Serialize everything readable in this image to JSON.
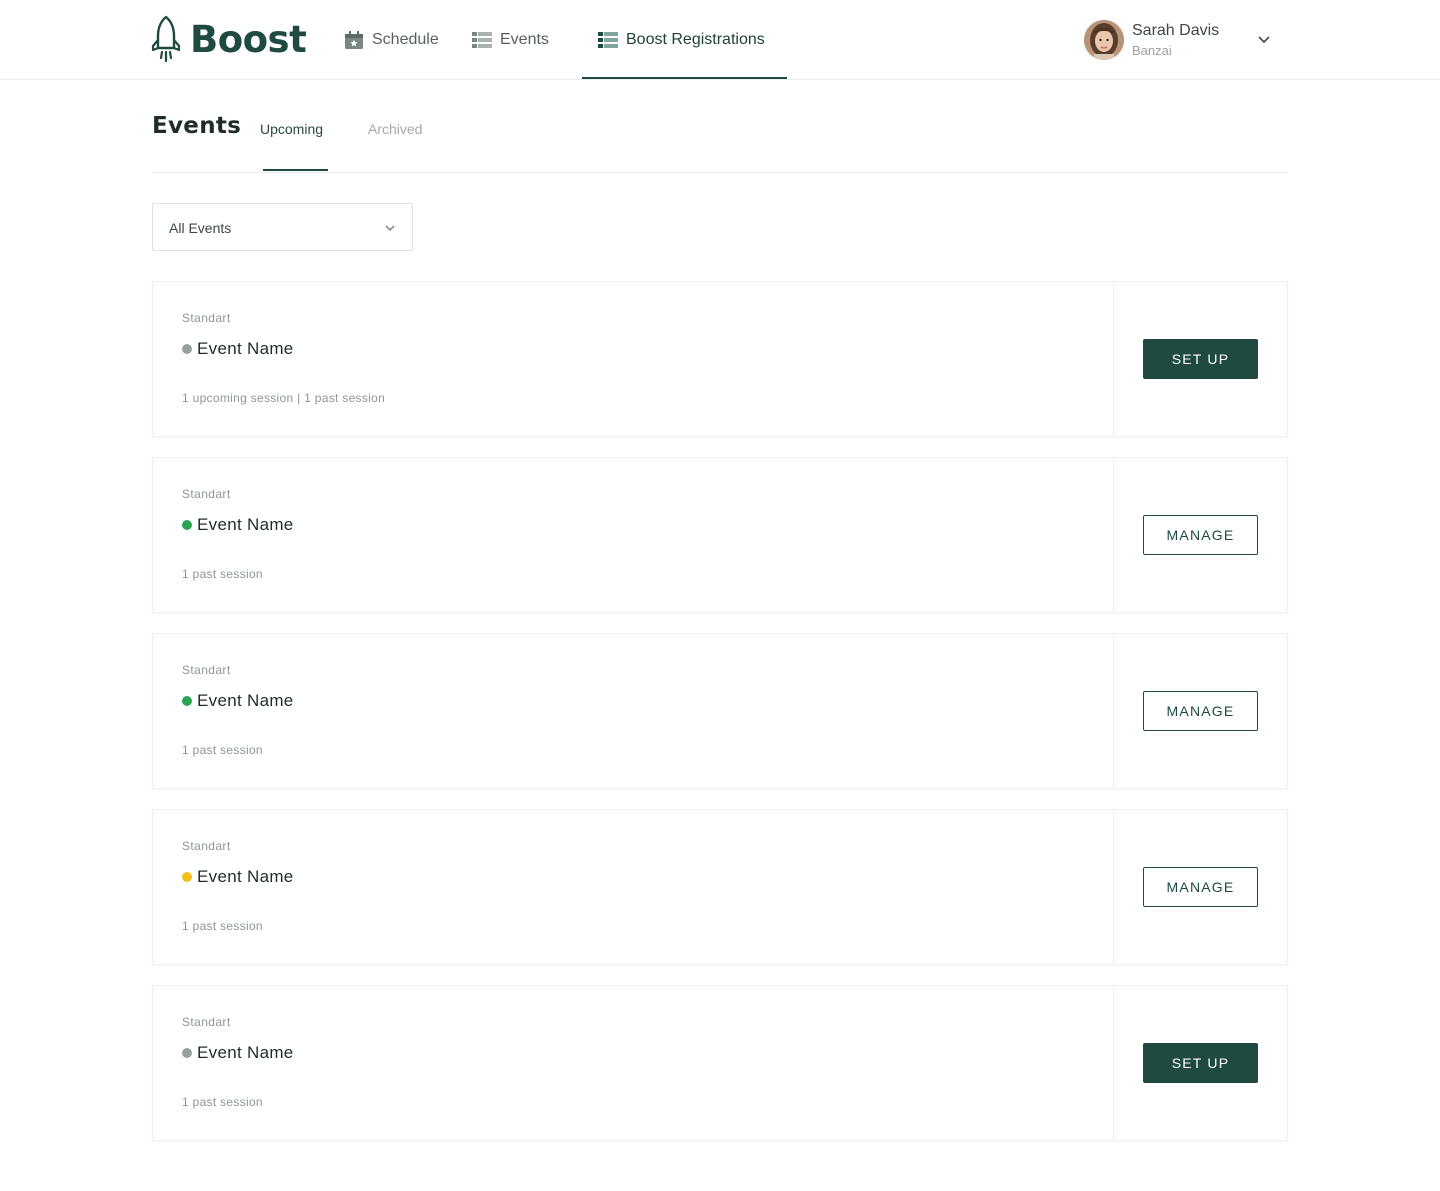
{
  "app": {
    "brand": "Boost"
  },
  "nav": {
    "items": [
      {
        "label": "Schedule",
        "icon": "calendar-star-icon"
      },
      {
        "label": "Events",
        "icon": "list-icon"
      },
      {
        "label": "Boost Registrations",
        "icon": "list-green-icon",
        "active": true
      }
    ]
  },
  "user": {
    "name": "Sarah Davis",
    "org": "Banzai"
  },
  "page": {
    "title": "Events",
    "tabs": [
      {
        "label": "Upcoming",
        "active": true
      },
      {
        "label": "Archived",
        "active": false
      }
    ]
  },
  "filter": {
    "value": "All Events"
  },
  "colors": {
    "accent": "#1e4a42",
    "status_inactive": "#9aa2a0",
    "status_active": "#2aa454",
    "status_pending": "#f0c01c"
  },
  "events": [
    {
      "type": "Standart",
      "name": "Event Name",
      "status": "inactive",
      "status_color": "#9aa2a0",
      "sessions": "1 upcoming session | 1 past session",
      "action": "SET UP",
      "action_style": "solid"
    },
    {
      "type": "Standart",
      "name": "Event Name",
      "status": "active",
      "status_color": "#2aa454",
      "sessions": "1 past session",
      "action": "MANAGE",
      "action_style": "outline"
    },
    {
      "type": "Standart",
      "name": "Event Name",
      "status": "active",
      "status_color": "#2aa454",
      "sessions": "1 past session",
      "action": "MANAGE",
      "action_style": "outline"
    },
    {
      "type": "Standart",
      "name": "Event Name",
      "status": "pending",
      "status_color": "#f0c01c",
      "sessions": "1 past session",
      "action": "MANAGE",
      "action_style": "outline"
    },
    {
      "type": "Standart",
      "name": "Event Name",
      "status": "inactive",
      "status_color": "#9aa2a0",
      "sessions": "1 past session",
      "action": "SET UP",
      "action_style": "solid"
    }
  ]
}
